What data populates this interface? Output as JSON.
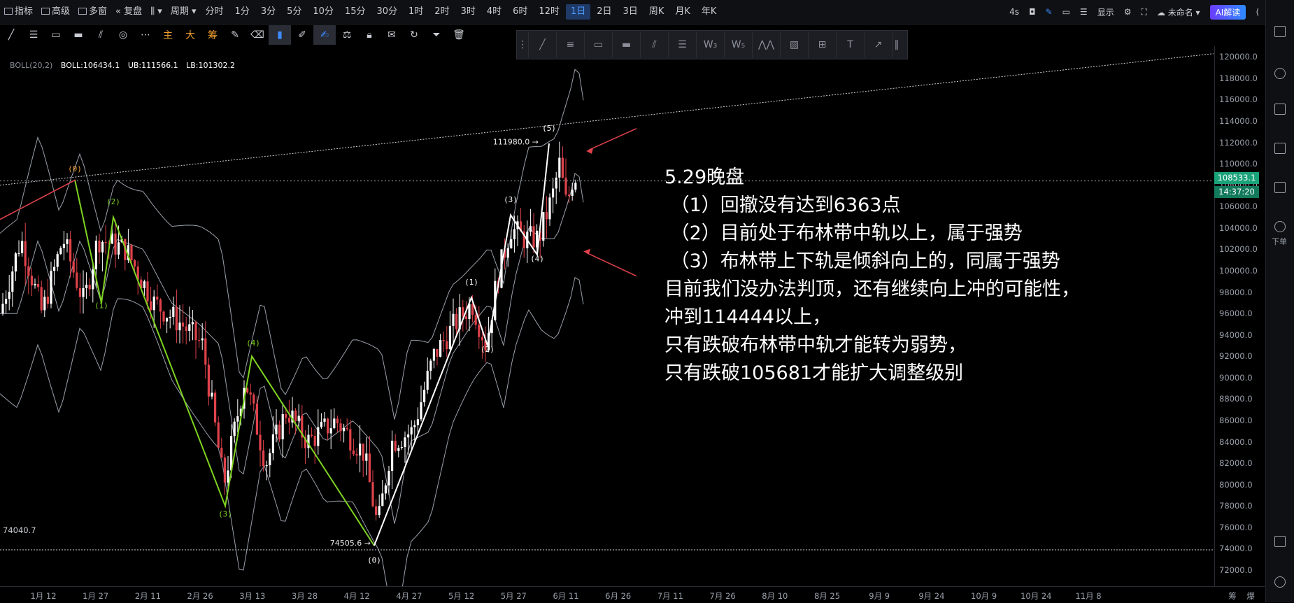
{
  "toolbar": {
    "indicator": "指标",
    "advanced": "高级",
    "multi_window": "多窗",
    "replay": "复盘",
    "period_label": "周期",
    "periods": [
      "分时",
      "1分",
      "3分",
      "5分",
      "10分",
      "15分",
      "30分",
      "1时",
      "2时",
      "3时",
      "4时",
      "6时",
      "12时",
      "1日",
      "2日",
      "3日",
      "周K",
      "月K",
      "年K"
    ],
    "active_period": "1日",
    "refresh": "4s",
    "display": "显示",
    "cloud": "未命名",
    "ai": "AI解读"
  },
  "indicator": {
    "name": "BOLL(20,2)",
    "boll": "BOLL:106434.1",
    "ub": "UB:111566.1",
    "lb": "LB:101302.2"
  },
  "right_sidebar": {
    "order_label": "下单"
  },
  "y_axis": {
    "ticks": [
      "120000.0",
      "118000.0",
      "116000.0",
      "114000.0",
      "112000.0",
      "110000.0",
      "108000.0",
      "106000.0",
      "104000.0",
      "102000.0",
      "100000.0",
      "98000.0",
      "96000.0",
      "94000.0",
      "92000.0",
      "90000.0",
      "88000.0",
      "86000.0",
      "84000.0",
      "82000.0",
      "80000.0",
      "78000.0",
      "76000.0",
      "74000.0",
      "72000.0"
    ],
    "current_price": "108533.1",
    "countdown": "14:37:20"
  },
  "x_axis": {
    "ticks": [
      "1月 12",
      "1月 27",
      "2月 11",
      "2月 26",
      "3月 13",
      "3月 28",
      "4月 12",
      "4月 27",
      "5月 12",
      "5月 27",
      "6月 11",
      "6月 26",
      "7月 11",
      "7月 26",
      "8月 10",
      "8月 25",
      "9月 9",
      "9月 24",
      "10月 9",
      "10月 24",
      "11月 8"
    ],
    "suffix_a": "筹",
    "suffix_b": "爆"
  },
  "chart_data": {
    "type": "candlestick",
    "high_label": "111980.0",
    "low_label": "74505.6",
    "left_low_label": "74040.7",
    "wave_labels_green": [
      "(0)",
      "(1)",
      "(2)",
      "(3)",
      "(4)"
    ],
    "wave_labels_white": [
      "(0)",
      "(1)",
      "(2)",
      "(3)",
      "(4)",
      "(5)"
    ],
    "ylim": [
      70500,
      121000
    ]
  },
  "annotation": {
    "lines": [
      "5.29晚盘",
      " （1）回撤没有达到6363点",
      " （2）目前处于布林带中轨以上，属于强势",
      " （3）布林带上下轨是倾斜向上的，同属于强势",
      "目前我们没办法判顶，还有继续向上冲的可能性，",
      "冲到114444以上，",
      "只有跌破布林带中轨才能转为弱势，",
      "只有跌破105681才能扩大调整级别"
    ]
  },
  "colors": {
    "up": "#ffffff",
    "down": "#e0424b",
    "wave_green": "#7ed321",
    "accent": "#1aa37a",
    "arrow": "#e0424b"
  }
}
